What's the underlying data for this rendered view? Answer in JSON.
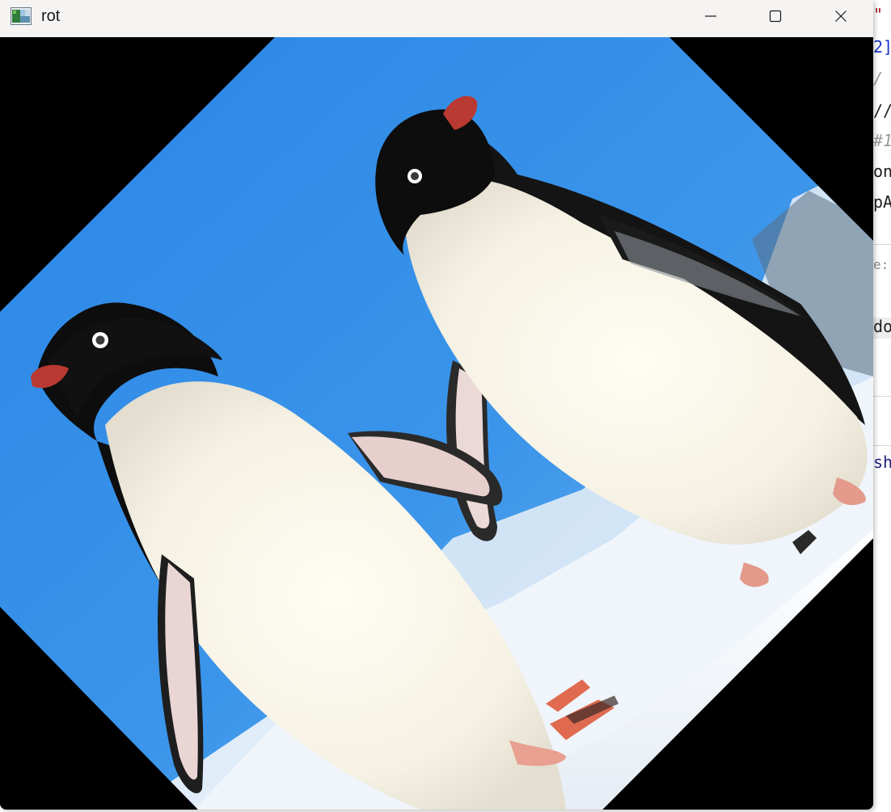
{
  "window": {
    "title": "rot",
    "app_icon": "image-viewer-icon",
    "controls": {
      "minimize_icon": "minimize-icon",
      "maximize_icon": "maximize-icon",
      "close_icon": "close-icon"
    }
  },
  "canvas": {
    "content": "image rotated 45 degrees showing two penguins on snow against blue sky",
    "background_color": "#000000",
    "sky_color": "#2f8be8",
    "snow_color": "#f4f7fb"
  },
  "background_editor": {
    "lines": [
      {
        "text": "\"",
        "kind": "str"
      },
      {
        "text": "2]",
        "kind": "num"
      },
      {
        "text": "/",
        "kind": "cmt"
      },
      {
        "text": "//",
        "kind": "code"
      },
      {
        "text": "#1",
        "kind": "cmt"
      },
      {
        "text": "on",
        "kind": "code"
      },
      {
        "text": "pA",
        "kind": "code"
      },
      {
        "text": "e:",
        "kind": "gray"
      },
      {
        "text": "do",
        "kind": "code"
      },
      {
        "text": "sh",
        "kind": "navy"
      }
    ]
  }
}
